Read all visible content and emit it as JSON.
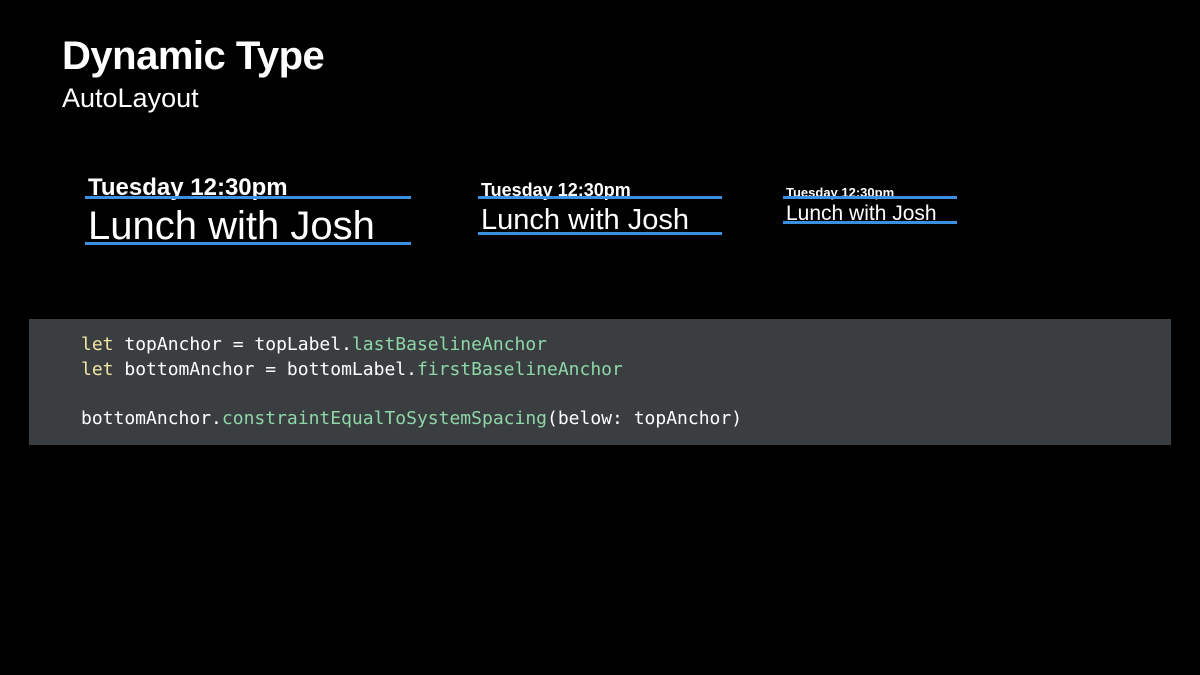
{
  "slide": {
    "title": "Dynamic Type",
    "subtitle": "AutoLayout"
  },
  "samples": [
    {
      "time": "Tuesday 12:30pm",
      "event": "Lunch with Josh"
    },
    {
      "time": "Tuesday 12:30pm",
      "event": "Lunch with Josh"
    },
    {
      "time": "Tuesday 12:30pm",
      "event": "Lunch with Josh"
    }
  ],
  "code": {
    "line1": {
      "keyword": "let",
      "text": " topAnchor = topLabel.",
      "member": "lastBaselineAnchor"
    },
    "line2": {
      "keyword": "let",
      "text": " bottomAnchor = bottomLabel.",
      "member": "firstBaselineAnchor"
    },
    "line3": {
      "text": "bottomAnchor.",
      "member": "constraintEqualToSystemSpacing",
      "tail": "(below: topAnchor)"
    }
  },
  "colors": {
    "background": "#000000",
    "baseline": "#3b8fe0",
    "code_background": "#3a3e40",
    "keyword": "#f2e6a4",
    "member": "#8fd6a8"
  }
}
